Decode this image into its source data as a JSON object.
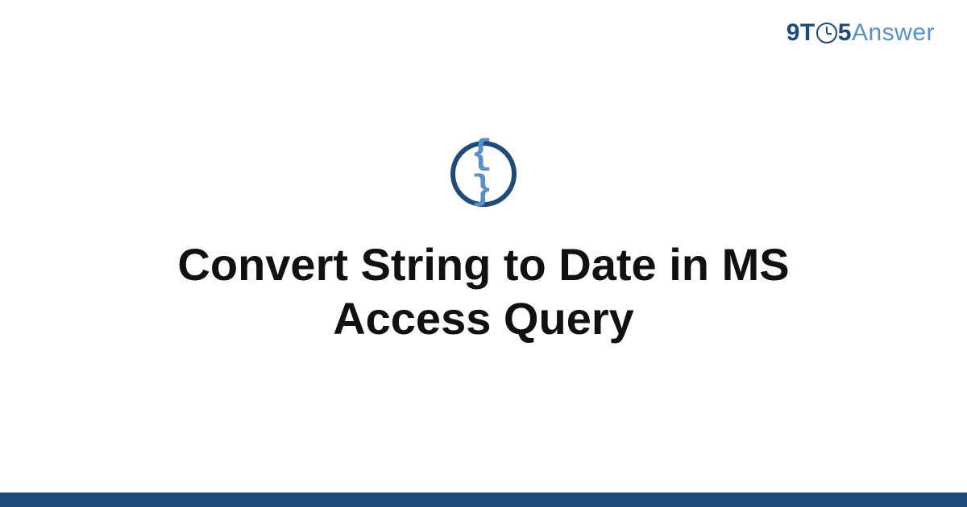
{
  "logo": {
    "part1": "9T",
    "part2": "5",
    "part3": "Answer"
  },
  "category_icon": {
    "glyph": "{ }",
    "name": "code-braces-icon"
  },
  "title": "Convert String to Date in MS Access Query",
  "colors": {
    "brand_dark": "#1e4a7a",
    "brand_light": "#5a8fc7",
    "text": "#111111",
    "background": "#ffffff"
  }
}
